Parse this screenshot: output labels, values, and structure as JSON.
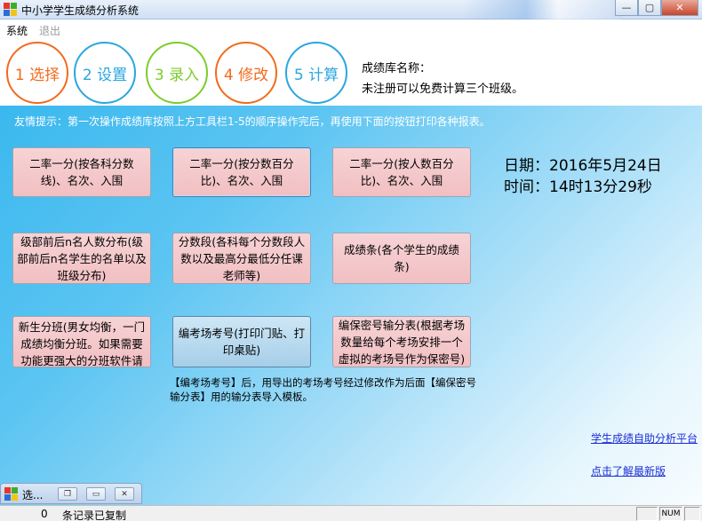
{
  "window": {
    "title": "中小学学生成绩分析系统",
    "min_label": "—",
    "max_label": "▢",
    "close_label": "✕"
  },
  "menu": {
    "items": [
      {
        "label": "系统",
        "enabled": true
      },
      {
        "label": "退出",
        "enabled": false
      }
    ]
  },
  "toolbar": {
    "steps": [
      {
        "label": "1 选择",
        "color": "#f26b1d"
      },
      {
        "label": "2 设置",
        "color": "#2aa6e0"
      },
      {
        "label": "3 录入",
        "color": "#7ccd2c"
      },
      {
        "label": "4 修改",
        "color": "#f26b1d"
      },
      {
        "label": "5 计算",
        "color": "#2aa6e0"
      }
    ],
    "db_name_label": "成绩库名称：",
    "register_note": "未注册可以免费计算三个班级。"
  },
  "main": {
    "tip": "友情提示：第一次操作成绩库按照上方工具栏1-5的顺序操作完后，再使用下面的按钮打印各种报表。",
    "buttons": [
      {
        "label": "二率一分(按各科分数线)、名次、入围"
      },
      {
        "label": "二率一分(按分数百分比)、名次、入围"
      },
      {
        "label": "二率一分(按人数百分比)、名次、入围"
      },
      {
        "label": "级部前后n名人数分布(级部前后n名学生的名单以及班级分布)"
      },
      {
        "label": "分数段(各科每个分数段人数以及最高分最低分任课老师等)"
      },
      {
        "label": "成绩条(各个学生的成绩条)"
      },
      {
        "label": "新生分班(男女均衡，一门成绩均衡分班。如果需要功能更强大的分班软件请"
      },
      {
        "label": "编考场考号(打印门贴、打印桌贴)"
      },
      {
        "label": "编保密号输分表(根据考场数量给每个考场安排一个虚拟的考场号作为保密号)"
      }
    ],
    "date_line": "日期：2016年5月24日",
    "time_line": "时间：14时13分29秒",
    "note": "【编考场考号】后，用导出的考场考号经过修改作为后面【编保密号输分表】用的输分表导入模板。",
    "link_platform": "学生成绩自助分析平台",
    "link_new": "点击了解最新版"
  },
  "minimized": {
    "label": "选..."
  },
  "status": {
    "count": "0",
    "text": "条记录已复制",
    "num_indicator": "NUM"
  }
}
